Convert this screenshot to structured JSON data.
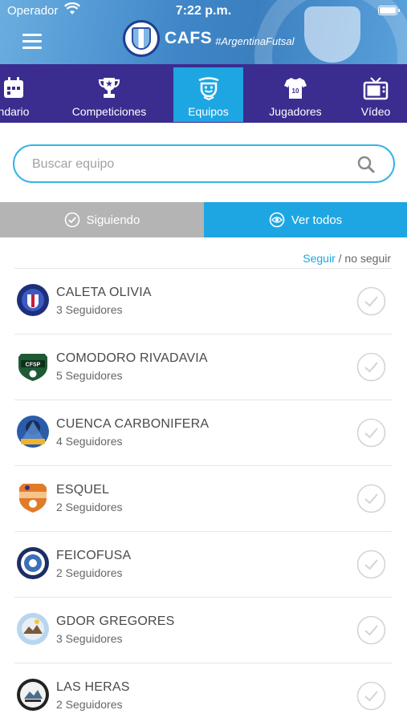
{
  "status_bar": {
    "carrier": "Operador",
    "time": "7:22 p.m."
  },
  "app_bar": {
    "brand_name": "CAFS",
    "brand_tag": "#ArgentinaFutsal"
  },
  "tabs": [
    {
      "label": "ndario",
      "icon": "calendar-icon",
      "active": false
    },
    {
      "label": "Competiciones",
      "icon": "trophy-icon",
      "active": false
    },
    {
      "label": "Equipos",
      "icon": "team-badge-icon",
      "active": true
    },
    {
      "label": "Jugadores",
      "icon": "jersey-icon",
      "active": false
    },
    {
      "label": "Vídeo",
      "icon": "tv-icon",
      "active": false
    }
  ],
  "search": {
    "placeholder": "Buscar equipo"
  },
  "segments": {
    "following_label": "Siguiendo",
    "all_label": "Ver todos"
  },
  "legend": {
    "follow": "Seguir",
    "separator": " / ",
    "unfollow": "no seguir"
  },
  "teams": [
    {
      "name": "CALETA OLIVIA",
      "followers": "3 Seguidores"
    },
    {
      "name": "COMODORO RIVADAVIA",
      "followers": "5 Seguidores"
    },
    {
      "name": "CUENCA CARBONIFERA",
      "followers": "4 Seguidores"
    },
    {
      "name": "ESQUEL",
      "followers": "2 Seguidores"
    },
    {
      "name": "FEICOFUSA",
      "followers": "2 Seguidores"
    },
    {
      "name": "GDOR GREGORES",
      "followers": "3 Seguidores"
    },
    {
      "name": "LAS HERAS",
      "followers": "2 Seguidores"
    }
  ],
  "colors": {
    "header_blue": "#3f86c8",
    "tabbar_purple": "#3b2c8f",
    "accent_cyan": "#1ea6e2",
    "segment_grey": "#b4b4b4"
  }
}
